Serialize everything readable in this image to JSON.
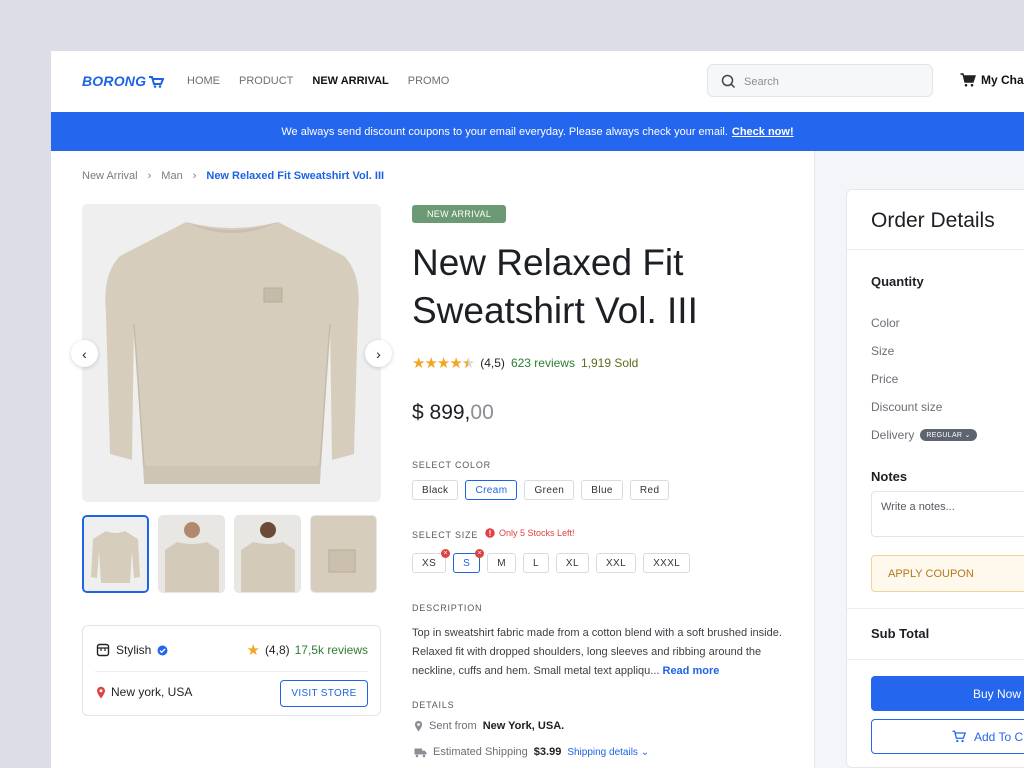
{
  "header": {
    "logo": "BORONG",
    "nav": [
      "HOME",
      "PRODUCT",
      "NEW ARRIVAL",
      "PROMO"
    ],
    "search_placeholder": "Search",
    "cart_label": "My Cha"
  },
  "banner": {
    "text": "We always send discount coupons to your email everyday. Please always check your email.",
    "link": "Check now!"
  },
  "breadcrumb": [
    "New Arrival",
    "Man",
    "New Relaxed Fit Sweatshirt Vol. III"
  ],
  "product": {
    "badge": "NEW ARRIVAL",
    "title_line1": "New Relaxed Fit",
    "title_line2": "Sweatshirt Vol. III",
    "rating_value": 4.5,
    "rating_text": "(4,5)",
    "reviews": "623 reviews",
    "sold": "1,919 Sold",
    "price_main": "$ 899,",
    "price_cents": "00",
    "color_label": "SELECT COLOR",
    "colors": [
      "Black",
      "Cream",
      "Green",
      "Blue",
      "Red"
    ],
    "selected_color": "Cream",
    "size_label": "SELECT SIZE",
    "stock_warning": "Only 5 Stocks Left!",
    "sizes": [
      "XS",
      "S",
      "M",
      "L",
      "XL",
      "XXL",
      "XXXL"
    ],
    "selected_size": "S",
    "description_label": "DESCRIPTION",
    "description": "Top in sweatshirt fabric made from a cotton blend with a soft brushed inside. Relaxed fit with dropped shoulders, long sleeves and ribbing around the neckline, cuffs and hem. Small metal text appliqu...",
    "read_more": "Read more",
    "details_label": "DETAILS",
    "sent_from_label": "Sent from",
    "sent_from": "New York, USA.",
    "shipping_label": "Estimated Shipping",
    "shipping_price": "$3.99",
    "shipping_link": "Shipping details"
  },
  "store": {
    "name": "Stylish",
    "rating": "(4,8)",
    "reviews": "17,5k reviews",
    "location": "New york, USA",
    "visit": "VISIT STORE"
  },
  "order": {
    "title": "Order Details",
    "quantity": "Quantity",
    "color": "Color",
    "size": "Size",
    "price": "Price",
    "discount": "Discount size",
    "delivery": "Delivery",
    "delivery_option": "REGULAR",
    "notes": "Notes",
    "notes_placeholder": "Write a notes...",
    "coupon": "APPLY COUPON",
    "subtotal": "Sub Total",
    "buy": "Buy Now",
    "add": "Add To C"
  },
  "colors": {
    "accent": "#2566ee",
    "badge": "#6b9a74",
    "star": "#f2a623",
    "warning": "#e04141"
  }
}
